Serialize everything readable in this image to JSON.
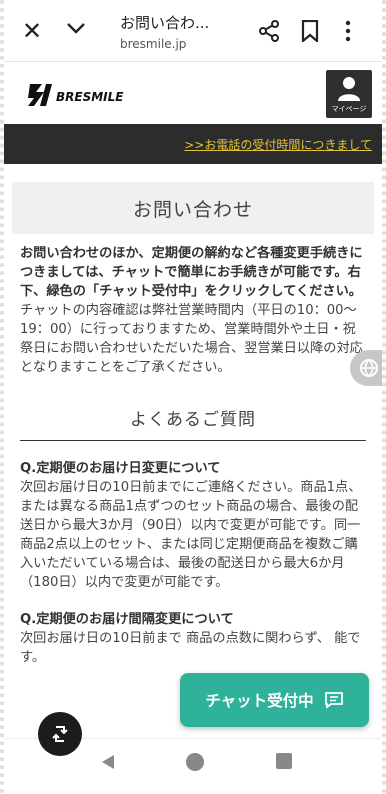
{
  "browser": {
    "title": "お問い合わ...",
    "domain": "bresmile.jp",
    "close_icon": "close-icon",
    "chevron_icon": "chevron-down-icon",
    "share_icon": "share-icon",
    "bookmark_icon": "bookmark-icon",
    "more_icon": "more-vert-icon"
  },
  "header": {
    "logo_alt": "BRESMILE",
    "mypage_label": "マイページ",
    "notice_link": ">>お電話の受付時間につきまして"
  },
  "page": {
    "title": "お問い合わせ",
    "lead_bold": "お問い合わせのほか、定期便の解約など各種変更手続きにつきましては、チャットで簡単にお手続きが可能です。右下、緑色の「チャット受付中」をクリックしてください。",
    "lead_sub": "チャットの内容確認は弊社営業時間内（平日の10：00〜19：00）に行っておりますため、営業時間外や土日・祝祭日にお問い合わせいただいた場合、翌営業日以降の対応となりますことをご了承ください。",
    "faq_heading": "よくあるご質問",
    "faq": [
      {
        "q": "Q.定期便のお届け日変更について",
        "a": "次回お届け日の10日前までにご連絡ください。商品1点、または異なる商品1点ずつのセット商品の場合、最後の配送日から最大3か月（90日）以内で変更が可能です。同一商品2点以上のセット、または同じ定期便商品を複数ご購入いただいている場合は、最後の配送日から最大6か月（180日）以内で変更が可能です。"
      },
      {
        "q": "Q.定期便のお届け間隔変更について",
        "a": "次回お届け日の10日前まで 商品の点数に関わらず、 能です。"
      }
    ]
  },
  "chat": {
    "label": "チャット受付中"
  },
  "colors": {
    "accent_green": "#2eb39a",
    "notice_bg": "#2c2c2c",
    "notice_link": "#e4c33a"
  }
}
